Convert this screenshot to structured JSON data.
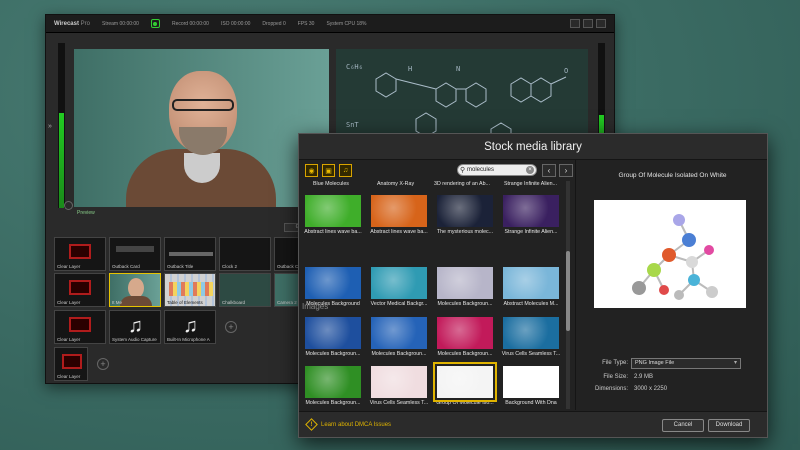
{
  "app": {
    "brand": "Wirecast",
    "brand_suffix": "Pro",
    "status": [
      "Stream 00:00:00",
      "Record 00:00:00",
      "ISO 00:00:00",
      "Dropped 0",
      "FPS 30",
      "System CPU 18%"
    ],
    "preview_tag": "Preview",
    "go_label": "Go",
    "rows": [
      [
        {
          "label": "Clear Layer"
        },
        {
          "label": "Outback Card"
        },
        {
          "label": "Outback Title"
        },
        {
          "label": "Clock 2"
        },
        {
          "label": "Outback Card 3"
        }
      ],
      [
        {
          "label": "Clear Layer"
        },
        {
          "label": "It Me",
          "selected": true
        },
        {
          "label": "Table of Elements"
        },
        {
          "label": "Chalkboard"
        },
        {
          "label": "Camera 2"
        }
      ],
      [
        {
          "label": "Clear Layer"
        },
        {
          "label": "System Audio Capture"
        },
        {
          "label": "Built-In Microphone A"
        }
      ],
      [
        {
          "label": "Clear Layer"
        }
      ]
    ]
  },
  "dialog": {
    "title": "Stock media library",
    "search_value": "molecules",
    "top_captions": [
      "Blue Molecules",
      "Anatomy X-Ray",
      "3D rendering of an Ab...",
      "Strange Infinite Alien..."
    ],
    "row1": [
      {
        "caption": "Abstract lines wave ba...",
        "color": "#3fae2a"
      },
      {
        "caption": "Abstract lines wave ba...",
        "color": "#d7641a"
      },
      {
        "caption": "The mysterious molec...",
        "color": "#1b2238"
      },
      {
        "caption": "Strange Infinite Alien...",
        "color": "#3a2060"
      }
    ],
    "section": "Images",
    "row2": [
      {
        "caption": "Molecules Background",
        "color": "#1e5fb3"
      },
      {
        "caption": "Vector Medical Backgr...",
        "color": "#2f9bb3"
      },
      {
        "caption": "Molecules Backgroun...",
        "color": "#b7b5c9"
      },
      {
        "caption": "Abstract Molecules M...",
        "color": "#7ab6d9"
      }
    ],
    "row3": [
      {
        "caption": "Molecules Backgroun...",
        "color": "#1e4f9e"
      },
      {
        "caption": "Molecules Backgroun...",
        "color": "#2563b8"
      },
      {
        "caption": "Molecules Backgroun...",
        "color": "#c21a5a"
      },
      {
        "caption": "Virus Cells Seamless T...",
        "color": "#1b6ea0"
      }
    ],
    "row4": [
      {
        "caption": "Molecules Backgroun...",
        "color": "#2f8f24"
      },
      {
        "caption": "Virus Cells Seamless T...",
        "color": "#f0dde0"
      },
      {
        "caption": "Group Of Molecule Iso...",
        "color": "#f4f4f4",
        "selected": true
      },
      {
        "caption": "Background With Dna",
        "color": "#ffffff"
      }
    ],
    "detail": {
      "title": "Group Of Molecule Isolated On White",
      "file_type_label": "File Type:",
      "file_type_value": "PNG Image File",
      "file_size_label": "File Size:",
      "file_size_value": "2.9 MB",
      "dimensions_label": "Dimensions:",
      "dimensions_value": "3000 x 2250"
    },
    "dmca_label": "Learn about DMCA Issues",
    "cancel_label": "Cancel",
    "download_label": "Download"
  }
}
